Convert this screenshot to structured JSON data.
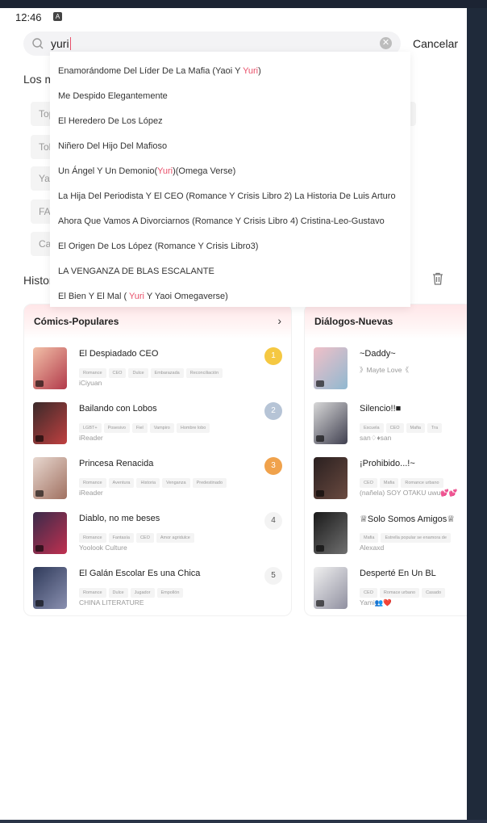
{
  "status_bar": {
    "time": "12:46",
    "app_icon": "A"
  },
  "search": {
    "query": "yuri",
    "clear_icon": "clear-icon",
    "cancel_label": "Cancelar"
  },
  "background": {
    "section_heading": "Los m",
    "chips": [
      "Top",
      "Tok",
      "Yac",
      "FAV",
      "Cas"
    ],
    "history_heading": "Histor"
  },
  "suggestions": [
    {
      "before": "Enamorándome Del Líder De La Mafia (Yaoi Y ",
      "match": "Yuri",
      "after": ")"
    },
    {
      "before": "Me Despido Elegantemente",
      "match": "",
      "after": ""
    },
    {
      "before": "El Heredero De Los López",
      "match": "",
      "after": ""
    },
    {
      "before": "Niñero Del Hijo Del Mafioso",
      "match": "",
      "after": ""
    },
    {
      "before": "Un Ángel Y Un Demonio(",
      "match": "Yuri",
      "after": ")(Omega Verse)"
    },
    {
      "before": "La Hija Del Periodista Y El CEO (Romance Y Crisis Libro 2) La Historia De Luis Arturo",
      "match": "",
      "after": ""
    },
    {
      "before": "Ahora Que Vamos A Divorciarnos (Romance Y Crisis Libro 4) Cristina-Leo-Gustavo",
      "match": "",
      "after": ""
    },
    {
      "before": "El Origen De Los López (Romance Y Crisis Libro3)",
      "match": "",
      "after": ""
    },
    {
      "before": "LA VENGANZA DE BLAS ESCALANTE",
      "match": "",
      "after": ""
    },
    {
      "before": "El Bien Y El Mal ( ",
      "match": "Yuri",
      "after": " Y Yaoi Omegaverse)"
    }
  ],
  "comics_card": {
    "title": "Cómics-Populares",
    "chevron": "›",
    "items": [
      {
        "title": "El Despiadado CEO",
        "tags": [
          "Romance",
          "CEO",
          "Dulce",
          "Embarazada",
          "Reconciliación"
        ],
        "author": "iCiyuan",
        "rank": "1",
        "cover": [
          "#f2c0a8",
          "#b23a4a"
        ]
      },
      {
        "title": "Bailando con Lobos",
        "tags": [
          "LGBT+",
          "Posesivo",
          "Fiel",
          "Vampiro",
          "Hombre lobo"
        ],
        "author": "iReader",
        "rank": "2",
        "cover": [
          "#3a2a2a",
          "#c04040"
        ]
      },
      {
        "title": "Princesa Renacida",
        "tags": [
          "Romance",
          "Aventura",
          "Historia",
          "Venganza",
          "Predestinado"
        ],
        "author": "iReader",
        "rank": "3",
        "cover": [
          "#e8d8d0",
          "#a07060"
        ]
      },
      {
        "title": "Diablo, no me beses",
        "tags": [
          "Romance",
          "Fantasía",
          "CEO",
          "Amor agridulce"
        ],
        "author": "Yoolook Culture",
        "rank": "4",
        "cover": [
          "#3a2b4a",
          "#c03050"
        ]
      },
      {
        "title": "El Galán Escolar Es una Chica",
        "tags": [
          "Romance",
          "Dulce",
          "Jugador",
          "Empollón"
        ],
        "author": "CHINA LITERATURE",
        "rank": "5",
        "cover": [
          "#2f3a5a",
          "#8a90b0"
        ]
      }
    ]
  },
  "dialogs_card": {
    "title": "Diálogos-Nuevas",
    "items": [
      {
        "title": "~Daddy~",
        "tags": [],
        "author": "》Mayte Love《",
        "cover": [
          "#f0c0c8",
          "#90b8d0"
        ]
      },
      {
        "title": "Silencio!!■",
        "tags": [
          "Escuela",
          "CEO",
          "Mafia",
          "Tra"
        ],
        "author": "san♢♦san",
        "cover": [
          "#d8d8d8",
          "#404050"
        ]
      },
      {
        "title": "¡Prohibido...!~",
        "tags": [
          "CEO",
          "Mafia",
          "Romance urbano"
        ],
        "author": "(nañela) SOY OTAKU uwu💕💕",
        "cover": [
          "#2a2020",
          "#6a4a40"
        ]
      },
      {
        "title": "♕Solo Somos Amigos♕",
        "tags": [
          "Mafia",
          "Estrella popular se enamora de"
        ],
        "author": "Alexaxd",
        "cover": [
          "#1a1a1a",
          "#707070"
        ]
      },
      {
        "title": "Desperté En Un BL",
        "tags": [
          "CEO",
          "Romace urbano",
          "Casado"
        ],
        "author": "Yami👥❤️",
        "cover": [
          "#f0f0f0",
          "#9090a0"
        ]
      }
    ]
  }
}
